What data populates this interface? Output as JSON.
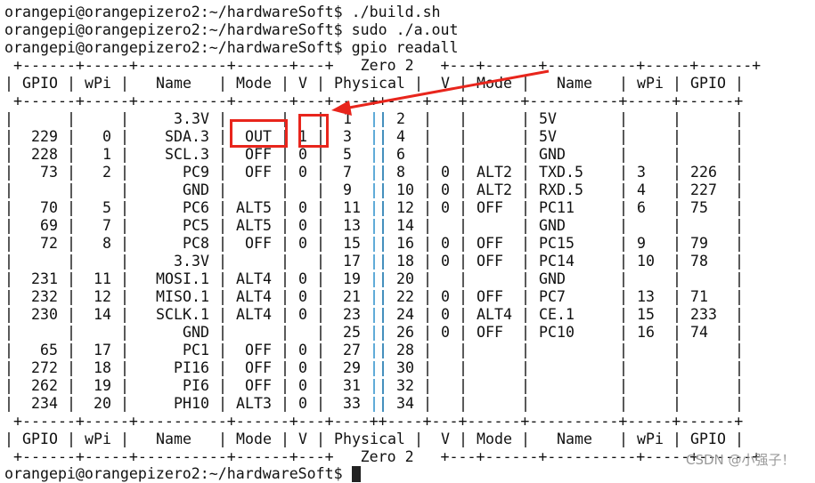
{
  "terminal": {
    "prompt": "orangepi@orangepizero2:~/hardwareSoft$",
    "commands": [
      "./build.sh",
      "sudo ./a.out",
      "gpio readall"
    ],
    "board_border": " +------+-----+----------+------+---+   Zero 2   +---+------+----------+-----+------+",
    "board_name": "Zero 2",
    "separator": " +------+-----+----------+------+---+----++----+---+------+----------+-----+------+",
    "header": [
      "GPIO",
      "wPi",
      "Name",
      "Mode",
      "V",
      "Physical",
      "V",
      "Mode",
      "Name",
      "wPi",
      "GPIO"
    ],
    "rows": [
      [
        "",
        "",
        "3.3V",
        "",
        "",
        "1",
        "2",
        "",
        "",
        "5V",
        "",
        ""
      ],
      [
        "229",
        "0",
        "SDA.3",
        "OUT",
        "1",
        "3",
        "4",
        "",
        "",
        "5V",
        "",
        ""
      ],
      [
        "228",
        "1",
        "SCL.3",
        "OFF",
        "0",
        "5",
        "6",
        "",
        "",
        "GND",
        "",
        ""
      ],
      [
        "73",
        "2",
        "PC9",
        "OFF",
        "0",
        "7",
        "8",
        "0",
        "ALT2",
        "TXD.5",
        "3",
        "226"
      ],
      [
        "",
        "",
        "GND",
        "",
        "",
        "9",
        "10",
        "0",
        "ALT2",
        "RXD.5",
        "4",
        "227"
      ],
      [
        "70",
        "5",
        "PC6",
        "ALT5",
        "0",
        "11",
        "12",
        "0",
        "OFF",
        "PC11",
        "6",
        "75"
      ],
      [
        "69",
        "7",
        "PC5",
        "ALT5",
        "0",
        "13",
        "14",
        "",
        "",
        "GND",
        "",
        ""
      ],
      [
        "72",
        "8",
        "PC8",
        "OFF",
        "0",
        "15",
        "16",
        "0",
        "OFF",
        "PC15",
        "9",
        "79"
      ],
      [
        "",
        "",
        "3.3V",
        "",
        "",
        "17",
        "18",
        "0",
        "OFF",
        "PC14",
        "10",
        "78"
      ],
      [
        "231",
        "11",
        "MOSI.1",
        "ALT4",
        "0",
        "19",
        "20",
        "",
        "",
        "GND",
        "",
        ""
      ],
      [
        "232",
        "12",
        "MISO.1",
        "ALT4",
        "0",
        "21",
        "22",
        "0",
        "OFF",
        "PC7",
        "13",
        "71"
      ],
      [
        "230",
        "14",
        "SCLK.1",
        "ALT4",
        "0",
        "23",
        "24",
        "0",
        "ALT4",
        "CE.1",
        "15",
        "233"
      ],
      [
        "",
        "",
        "GND",
        "",
        "",
        "25",
        "26",
        "0",
        "OFF",
        "PC10",
        "16",
        "74"
      ],
      [
        "65",
        "17",
        "PC1",
        "OFF",
        "0",
        "27",
        "28",
        "",
        "",
        "",
        "",
        ""
      ],
      [
        "272",
        "18",
        "PI16",
        "OFF",
        "0",
        "29",
        "30",
        "",
        "",
        "",
        "",
        ""
      ],
      [
        "262",
        "19",
        "PI6",
        "OFF",
        "0",
        "31",
        "32",
        "",
        "",
        "",
        "",
        ""
      ],
      [
        "234",
        "20",
        "PH10",
        "ALT3",
        "0",
        "33",
        "34",
        "",
        "",
        "",
        "",
        ""
      ]
    ]
  },
  "annotation": {
    "color": "#e8251c"
  },
  "watermark": "CSDN @小强子！"
}
